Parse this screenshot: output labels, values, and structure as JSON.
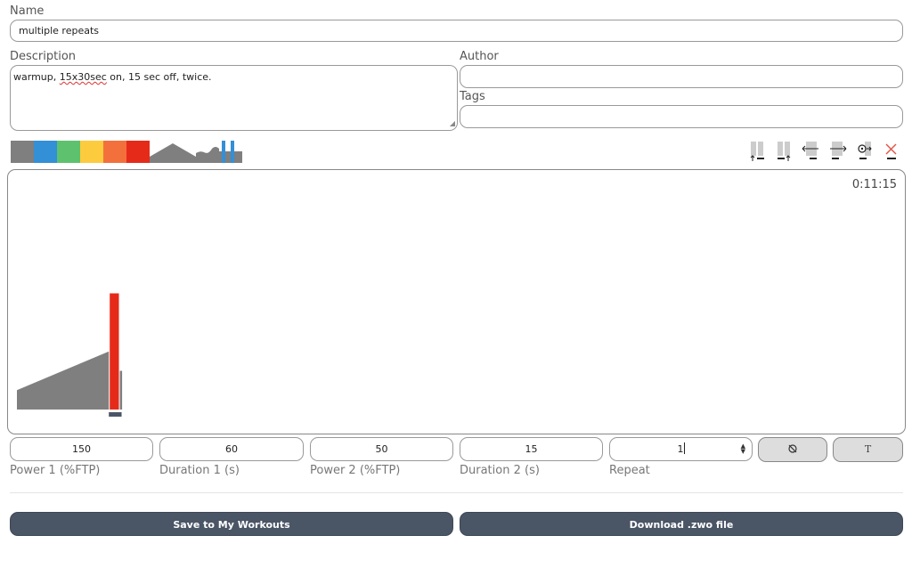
{
  "name": {
    "label": "Name",
    "value": "multiple repeats"
  },
  "description": {
    "label": "Description",
    "text_before": "warmup, ",
    "text_misspelled": "15x30sec",
    "text_after": " on, 15 sec off, twice."
  },
  "author": {
    "label": "Author",
    "value": ""
  },
  "tags": {
    "label": "Tags",
    "value": ""
  },
  "zone_palette": {
    "colors": [
      "#7f7f7f",
      "#338fd6",
      "#5ec16e",
      "#fdcb3e",
      "#f3703d",
      "#e62a1a"
    ],
    "shape_icons": [
      "warmup-icon",
      "cooldown-icon",
      "freeride-icon",
      "intervals-icon"
    ],
    "shape_color": "#7f7f7f",
    "interval_color": "#338fd6"
  },
  "toolbar_icons": [
    "insert-before-icon",
    "insert-after-icon",
    "move-left-icon",
    "move-right-icon",
    "duplicate-icon",
    "delete-icon"
  ],
  "workout": {
    "total_duration": "0:11:15",
    "segments": [
      {
        "type": "warmup",
        "duration_s": 600,
        "power_low_pct": 25,
        "power_high_pct": 75,
        "color": "#7f7f7f"
      },
      {
        "type": "interval-on",
        "duration_s": 60,
        "power_pct": 150,
        "color": "#e62a1a"
      },
      {
        "type": "interval-off",
        "duration_s": 15,
        "power_pct": 50,
        "color": "#7f7f7f"
      }
    ],
    "selected_segment": 1
  },
  "interval_editor": {
    "power1": {
      "value": "150",
      "label": "Power 1 (%FTP)"
    },
    "duration1": {
      "value": "60",
      "label": "Duration 1 (s)"
    },
    "power2": {
      "value": "50",
      "label": "Power 2 (%FTP)"
    },
    "duration2": {
      "value": "15",
      "label": "Duration 2 (s)"
    },
    "repeat": {
      "value": "1",
      "label": "Repeat"
    },
    "cycle_icon": "cycle-icon",
    "text_button": "T"
  },
  "actions": {
    "save": "Save to My Workouts",
    "download": "Download .zwo file"
  }
}
